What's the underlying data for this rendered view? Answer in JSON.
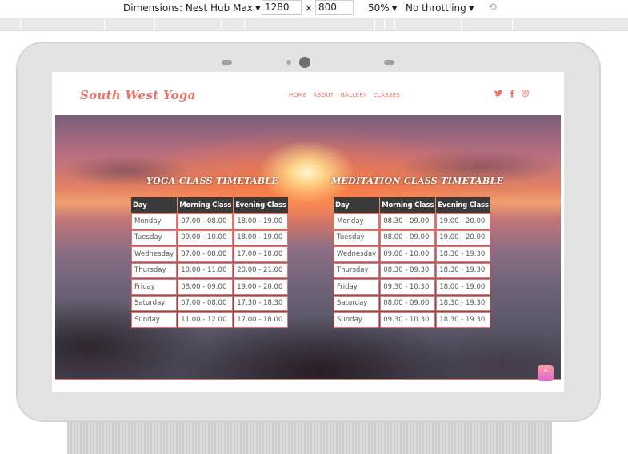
{
  "devtools": {
    "dimensions_label": "Dimensions: Nest Hub Max",
    "width_value": "1280",
    "times": "×",
    "height_value": "800",
    "zoom": "50%",
    "throttling": "No throttling",
    "rotate_icon": "rotate-icon"
  },
  "site": {
    "logo": "South West Yoga",
    "nav": [
      "HOME",
      "ABOUT",
      "GALLERY",
      "CLASSES"
    ],
    "active_nav": "CLASSES",
    "social_icons": [
      "twitter-icon",
      "facebook-icon",
      "instagram-icon"
    ]
  },
  "yoga": {
    "title": "YOGA CLASS TIMETABLE",
    "headers": [
      "Day",
      "Morning Class",
      "Evening Class"
    ],
    "rows": [
      [
        "Monday",
        "07.00 - 08.00",
        "18.00 - 19.00"
      ],
      [
        "Tuesday",
        "09.00 - 10.00",
        "18.00 - 19.00"
      ],
      [
        "Wednesday",
        "07.00 - 08.00",
        "17.00 - 18.00"
      ],
      [
        "Thursday",
        "10.00 - 11.00",
        "20.00 - 21.00"
      ],
      [
        "Friday",
        "08.00 - 09.00",
        "19.00 - 20.00"
      ],
      [
        "Saturday",
        "07.00 - 08.00",
        "17.30 - 18.30"
      ],
      [
        "Sunday",
        "11.00 - 12.00",
        "17.00 - 18.00"
      ]
    ]
  },
  "meditation": {
    "title": "MEDITATION CLASS TIMETABLE",
    "headers": [
      "Day",
      "Morning Class",
      "Evening Class"
    ],
    "rows": [
      [
        "Monday",
        "08.30 - 09.00",
        "19.00 - 20.00"
      ],
      [
        "Tuesday",
        "08.00 - 09.00",
        "19.00 - 20.00"
      ],
      [
        "Wednesday",
        "09.00 - 10.00",
        "18.30 - 19.30"
      ],
      [
        "Thursday",
        "08.30 - 09.30",
        "18.30 - 19.30"
      ],
      [
        "Friday",
        "09.30 - 10.30",
        "18.00 - 19.00"
      ],
      [
        "Saturday",
        "08.00 - 09.00",
        "18.30 - 19.30"
      ],
      [
        "Sunday",
        "09.30 - 10.30",
        "18.30 - 19.30"
      ]
    ]
  },
  "colors": {
    "accent": "#f07168",
    "header_bg": "#3a3a3a"
  },
  "back_to_top_icon": "chevron-up-icon"
}
